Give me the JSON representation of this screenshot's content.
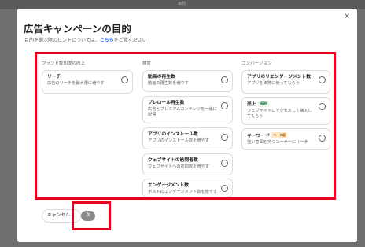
{
  "topbar": {
    "text": "目的"
  },
  "dialog": {
    "title": "広告キャンペーンの目的",
    "subtitle_prefix": "目的を選ぶ際のヒントについては、",
    "subtitle_link": "こちら",
    "subtitle_suffix": "をご覧ください",
    "close_icon": "×"
  },
  "columns": [
    {
      "header": "ブランド認知度の向上",
      "cards": [
        {
          "title": "リーチ",
          "desc": "広告のリーチを最大限に増やす"
        }
      ]
    },
    {
      "header": "検討",
      "cards": [
        {
          "title": "動画の再生数",
          "desc": "動画の再生数を増やす"
        },
        {
          "title": "プレロール再生数",
          "desc": "広告とプレミアムコンテンツを一緒に配信"
        },
        {
          "title": "アプリのインストール数",
          "desc": "アプリのインストール数を増やす"
        },
        {
          "title": "ウェブサイトの訪問者数",
          "desc": "ウェブサイトへの訪問数を増やす"
        },
        {
          "title": "エンゲージメント数",
          "desc": "ポストのエンゲージメント数を増やす"
        }
      ]
    },
    {
      "header": "コンバージョン",
      "cards": [
        {
          "title": "アプリのリエンゲージメント数",
          "desc": "アプリを実際に使ってもらう"
        },
        {
          "title": "売上",
          "badge": "NEW",
          "desc": "ウェブサイトにアクセスして購入してもらう"
        },
        {
          "title": "キーワード",
          "badge": "ベータ版",
          "desc": "強い意図を持つユーザーにリーチ"
        }
      ]
    }
  ],
  "footer": {
    "cancel_label": "キャンセル",
    "next_label": "次"
  },
  "colors": {
    "highlight": "#e8001c",
    "link": "#1a73e8",
    "next_button": "#8a8a8a"
  }
}
